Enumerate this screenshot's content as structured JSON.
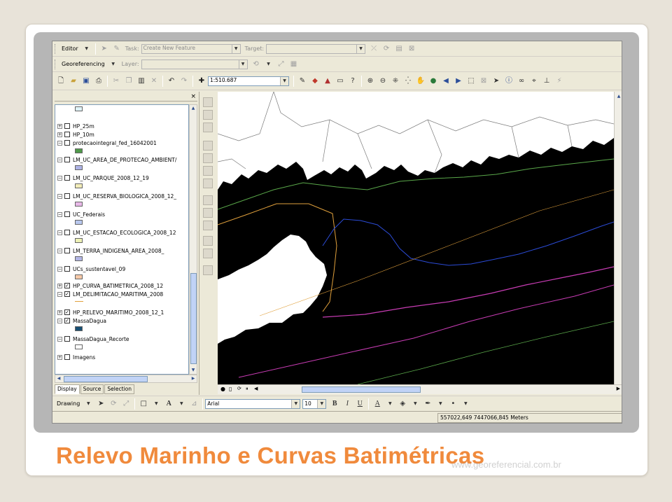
{
  "slide_title": "Relevo Marinho e Curvas Batimétricas",
  "watermark": "www.georeferencial.com.br",
  "editor_toolbar": {
    "editor_label": "Editor",
    "task_label": "Task:",
    "task_value": "Create New Feature",
    "target_label": "Target:",
    "target_value": ""
  },
  "georef_toolbar": {
    "georef_label": "Georeferencing",
    "layer_label": "Layer:",
    "layer_value": ""
  },
  "standard_toolbar": {
    "scale_value": "1:510.687"
  },
  "toc": {
    "layers": [
      {
        "label": "HP_25m",
        "expand": "+",
        "checked": false
      },
      {
        "label": "HP_10m",
        "expand": "+",
        "checked": false
      },
      {
        "label": "protecaointegral_fed_16042001",
        "expand": "−",
        "checked": false,
        "swatch": "#4f9a4a"
      },
      {
        "label": "LM_UC_AREA_DE_PROTECAO_AMBIENT/",
        "expand": "−",
        "checked": false,
        "swatch": "#aeb3e6"
      },
      {
        "label": "LM_UC_PARQUE_2008_12_19",
        "expand": "−",
        "checked": false,
        "swatch": "#f2ecb8"
      },
      {
        "label": "LM_UC_RESERVA_BIOLOGICA_2008_12_",
        "expand": "−",
        "checked": false,
        "swatch": "#e8b8e8"
      },
      {
        "label": "UC_Federais",
        "expand": "−",
        "checked": false,
        "swatch": "#b9c8ef"
      },
      {
        "label": "LM_UC_ESTACAO_ECOLOGICA_2008_12",
        "expand": "−",
        "checked": false,
        "swatch": "#eef2b6"
      },
      {
        "label": "LM_TERRA_INDIGENA_AREA_2008_",
        "expand": "−",
        "checked": false,
        "swatch": "#b3b6e6"
      },
      {
        "label": "UCs_sustentavel_09",
        "expand": "−",
        "checked": false,
        "swatch": "#f6c9a8"
      },
      {
        "label": "HP_CURVA_BATIMETRICA_2008_12",
        "expand": "+",
        "checked": true
      },
      {
        "label": "LM_DELIMITACAO_MARITIMA_2008",
        "expand": "−",
        "checked": true
      },
      {
        "label": "HP_RELEVO_MARITIMO_2008_12_1",
        "expand": "+",
        "checked": true
      },
      {
        "label": "MassaDagua",
        "expand": "−",
        "checked": true,
        "swatch": "#174e73"
      },
      {
        "label": "MassaDagua_Recorte",
        "expand": "−",
        "checked": false,
        "swatch": "#ffffff"
      },
      {
        "label": "Imagens",
        "expand": "+",
        "checked": false
      }
    ],
    "tabs": [
      "Display",
      "Source",
      "Selection"
    ]
  },
  "draw_toolbar": {
    "drawing_label": "Drawing",
    "font_name": "Arial",
    "font_size": "10",
    "bold": "B",
    "italic": "I",
    "underline": "U",
    "text_color_label": "A"
  },
  "status": {
    "coordinates": "557022,649  7447066,845 Meters"
  },
  "colors": {
    "sea": "#174e73",
    "title_orange": "#f08a3c",
    "bathymetry_blue": "#2b4bd6",
    "bathymetry_magenta": "#c83cb4",
    "bathymetry_green": "#5aa84a",
    "bathymetry_orange": "#e0a03c"
  }
}
